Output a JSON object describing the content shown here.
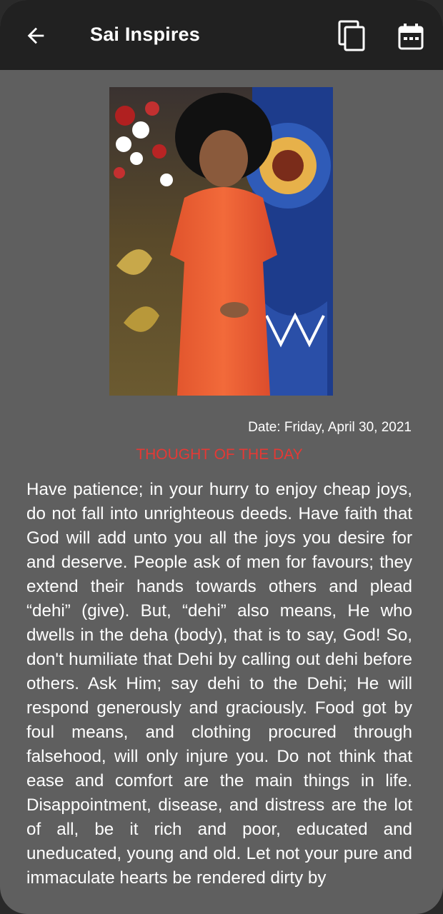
{
  "appbar": {
    "title": "Sai Inspires",
    "back_icon": "arrow-left-icon",
    "copy_icon": "copy-icon",
    "calendar_icon": "calendar-icon"
  },
  "content": {
    "date": "Date: Friday, April 30, 2021",
    "heading": "THOUGHT OF THE DAY",
    "body": "Have patience; in your hurry to enjoy cheap joys, do not fall into unrighteous deeds. Have faith that God will add unto you all the joys you desire for and deserve. People ask of men for favours; they extend their hands towards others and plead “dehi” (give). But, “dehi” also means, He who dwells in the deha (body), that is to say, God! So, don't humiliate that Dehi by calling out dehi before others. Ask Him; say dehi to the Dehi; He will respond generously and graciously. Food got by foul means, and clothing procured through falsehood, will only injure you. Do not think that ease and comfort are the main things in life. Disappointment, disease, and distress are the lot of all, be it rich and poor, educated and uneducated, young and old. Let not your pure and immaculate hearts be rendered dirty by"
  },
  "colors": {
    "appbar_bg": "#212121",
    "page_bg": "#5f5f5f",
    "heading": "#e53935",
    "text": "#ffffff"
  }
}
